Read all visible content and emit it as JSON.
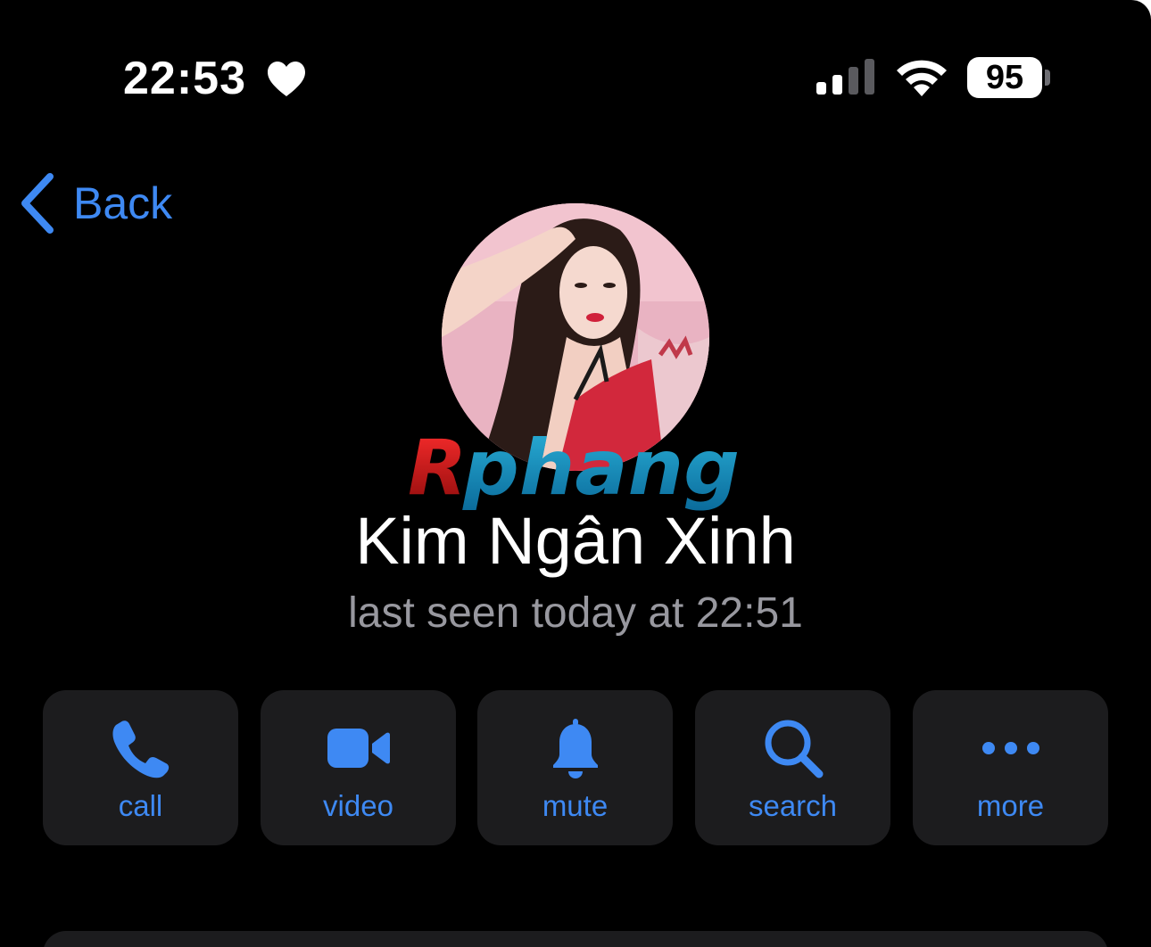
{
  "status_bar": {
    "time": "22:53",
    "time_icon": "heart-icon",
    "signal_icon": "cellular-signal-icon",
    "wifi_icon": "wifi-icon",
    "battery_level": "95"
  },
  "nav": {
    "back_label": "Back",
    "back_icon": "chevron-left-icon"
  },
  "profile": {
    "name": "Kim Ngân Xinh",
    "status": "last seen today at 22:51",
    "watermark_text": "Rphang"
  },
  "actions": [
    {
      "label": "call",
      "icon": "phone-icon"
    },
    {
      "label": "video",
      "icon": "video-camera-icon"
    },
    {
      "label": "mute",
      "icon": "bell-icon"
    },
    {
      "label": "search",
      "icon": "search-icon"
    },
    {
      "label": "more",
      "icon": "more-dots-icon"
    }
  ],
  "colors": {
    "background": "#000000",
    "accent": "#3e89f3",
    "card": "#1c1c1e",
    "secondary_text": "#98989f",
    "primary_text": "#ffffff"
  }
}
